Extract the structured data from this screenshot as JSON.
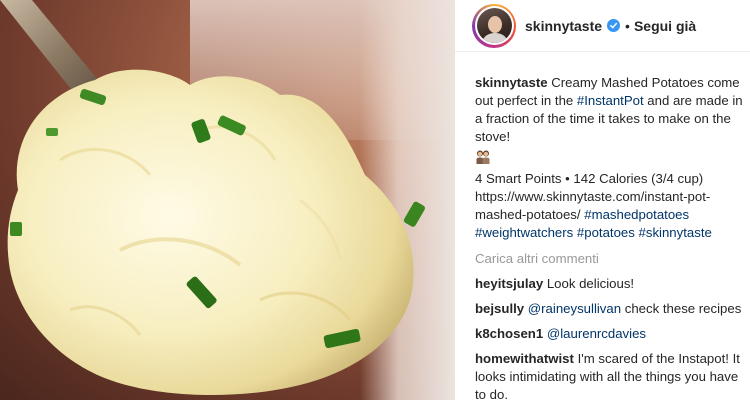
{
  "post": {
    "username": "skinnytaste",
    "follow_label": "Segui già",
    "separator": "•"
  },
  "caption": {
    "username": "skinnytaste",
    "text_1": " Creamy Mashed Potatoes come out perfect in the ",
    "tag_instantpot": "#InstantPot",
    "text_2": " and are made in a fraction of the time it takes to make on the stove!",
    "stats": "4 Smart Points • 142 Calories (3/4 cup)",
    "url": "https://www.skinnytaste.com/instant-pot-mashed-potatoes/",
    "tag_mashed": "#mashedpotatoes",
    "tag_ww": "#weightwatchers",
    "tag_potatoes": "#potatoes",
    "tag_skinny": "#skinnytaste",
    "emoji_icon": "family-emoji-icon"
  },
  "load_more": "Carica altri commenti",
  "comments": [
    {
      "user": "heyitsjulay",
      "text": " Look delicious!"
    },
    {
      "user": "bejsully",
      "mention": "@raineysullivan",
      "text": " check these recipes"
    },
    {
      "user": "k8chosen1",
      "mention": "@laurenrcdavies",
      "text": ""
    },
    {
      "user": "homewithatwist",
      "text": " I'm scared of the Instapot! It looks intimidating with all the things you have to do."
    }
  ],
  "colors": {
    "link": "#003569",
    "muted": "#999999",
    "verified": "#3897f0"
  }
}
